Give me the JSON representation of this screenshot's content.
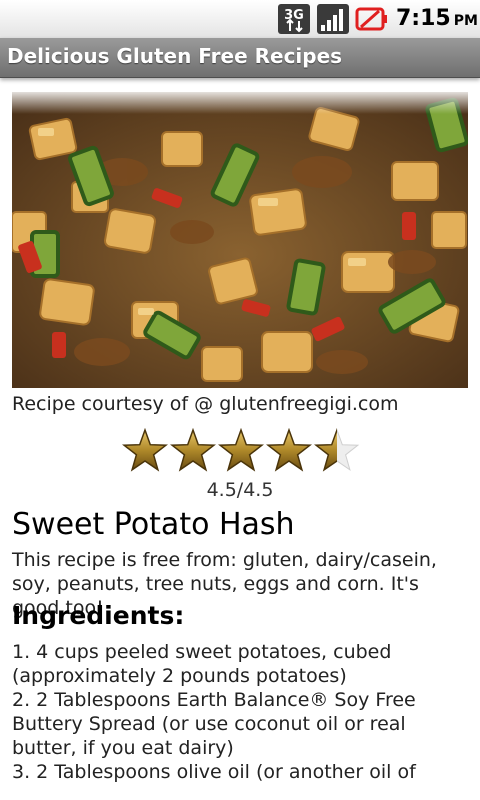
{
  "status_bar": {
    "network_badge": "3G",
    "time": "7:15",
    "ampm": "PM",
    "icons": [
      "3g-data-icon",
      "signal-bars-icon",
      "battery-empty-icon"
    ]
  },
  "header": {
    "title": "Delicious Gluten Free Recipes"
  },
  "recipe": {
    "image_alt": "sweet-potato-hash-photo",
    "credit": "Recipe courtesy of @ glutenfreegigi.com",
    "rating_value": 4.5,
    "rating_max": 5,
    "rating_text": "4.5/4.5",
    "title": "Sweet Potato Hash",
    "description": "This recipe is free from: gluten, dairy/casein, soy, peanuts, tree nuts, eggs and corn. It's good too!",
    "ingredients_heading": "Ingredients:",
    "ingredients": [
      "1. 4 cups peeled sweet potatoes, cubed (approximately 2 pounds potatoes)",
      "2. 2 Tablespoons Earth Balance® Soy Free Buttery Spread (or use coconut oil or real butter, if you eat dairy)",
      "3. 2 Tablespoons olive oil (or another oil of"
    ]
  },
  "colors": {
    "title_bar": "#8a8a8a",
    "star_gold": "#b08a2a",
    "star_dark": "#5e4410",
    "battery_red": "#e02020"
  }
}
